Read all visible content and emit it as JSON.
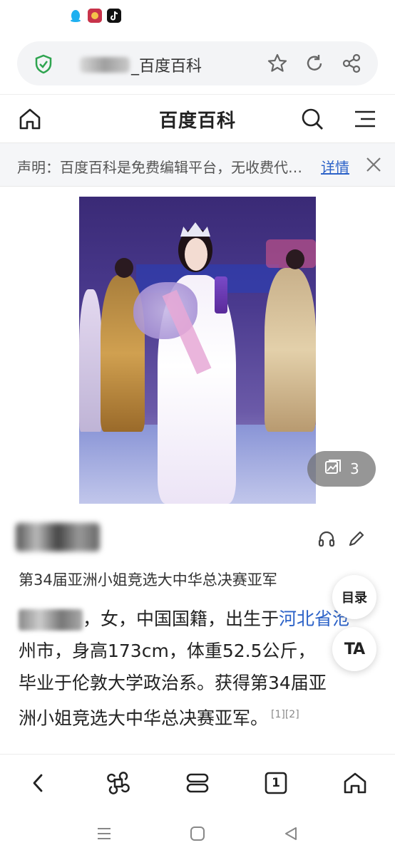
{
  "status_bar": {
    "icons": [
      "qq-icon",
      "app-badge-icon",
      "tiktok-icon"
    ]
  },
  "address_bar": {
    "url_title": "_百度百科",
    "icons": [
      "shield-check-icon",
      "star-icon",
      "refresh-icon",
      "share-icon"
    ],
    "accent": "#2ea44f"
  },
  "header": {
    "title": "百度百科",
    "icons": [
      "home-icon",
      "search-icon",
      "menu-icon"
    ]
  },
  "notice": {
    "text": "声明：百度百科是免费编辑平台，无收费代…",
    "link": "详情",
    "close_icon": "close-icon"
  },
  "gallery": {
    "count": "3",
    "icon": "gallery-icon"
  },
  "entry": {
    "subtitle": "第34届亚洲小姐竞选大中华总决赛亚军",
    "summary": {
      "line1_prefix": "，女，中国国籍，出生于",
      "line1_link": "河北省沧",
      "line2": "州市，身高173cm，体重52.5公斤，",
      "line3": "毕业于伦敦大学政治系。获得第34届亚",
      "line4": "洲小姐竞选大中华总决赛亚军。",
      "refs": "[1][2]"
    },
    "action_icons": [
      "headphones-icon",
      "edit-icon"
    ]
  },
  "float_buttons": {
    "toc": "目录",
    "font": "TA"
  },
  "bottom_bar": {
    "tab_count": "1",
    "icons": [
      "back-icon",
      "command-icon",
      "multi-window-icon",
      "tabs-icon",
      "home-icon"
    ]
  },
  "system_nav": {
    "icons": [
      "recent-apps-icon",
      "home-circle-icon",
      "back-triangle-icon"
    ]
  },
  "colors": {
    "link": "#2d63c8",
    "notice_bg": "#f5f6f8",
    "secure": "#2ea44f"
  }
}
